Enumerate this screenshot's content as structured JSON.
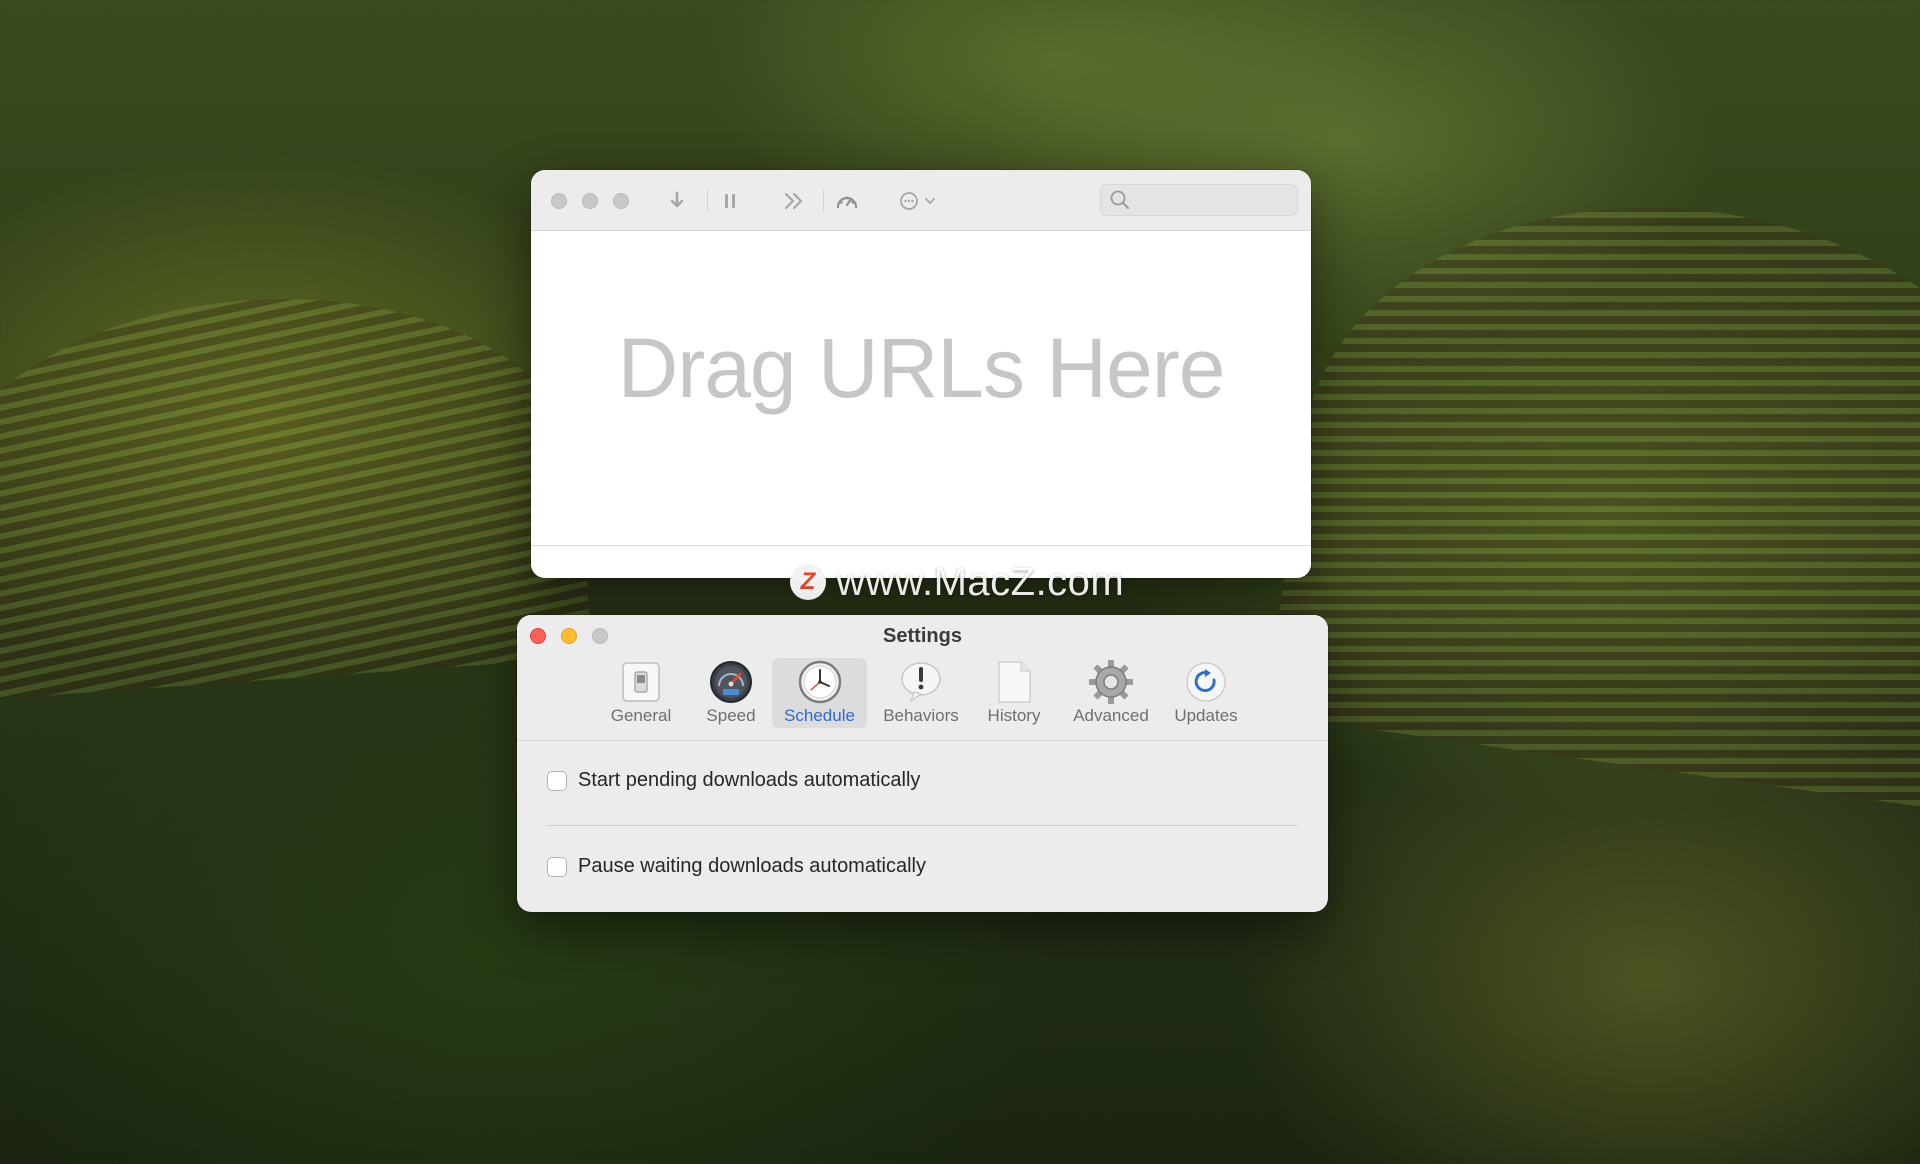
{
  "main_window": {
    "toolbar": {
      "download_icon": "down-arrow-icon",
      "pause_icon": "pause-icon",
      "skip_icon": "double-chevron-icon",
      "speed_icon": "speedometer-icon",
      "more_icon": "ellipsis-circle-icon",
      "search_placeholder": ""
    },
    "drop_prompt": "Drag URLs Here"
  },
  "watermark": {
    "logo_letter": "Z",
    "text": "www.MacZ.com"
  },
  "settings": {
    "title": "Settings",
    "tabs": [
      {
        "label": "General",
        "icon": "light-switch-icon",
        "selected": false
      },
      {
        "label": "Speed",
        "icon": "speedometer-icon",
        "selected": false
      },
      {
        "label": "Schedule",
        "icon": "clock-icon",
        "selected": true
      },
      {
        "label": "Behaviors",
        "icon": "exclamation-bubble-icon",
        "selected": false
      },
      {
        "label": "History",
        "icon": "document-icon",
        "selected": false
      },
      {
        "label": "Advanced",
        "icon": "gear-icon",
        "selected": false
      },
      {
        "label": "Updates",
        "icon": "refresh-icon",
        "selected": false
      }
    ],
    "options": [
      {
        "label": "Start pending downloads automatically",
        "checked": false
      },
      {
        "label": "Pause waiting downloads automatically",
        "checked": false
      }
    ],
    "colors": {
      "accent": "#2a6ad8",
      "close": "#ff5f57",
      "minimize": "#febc2e"
    }
  }
}
